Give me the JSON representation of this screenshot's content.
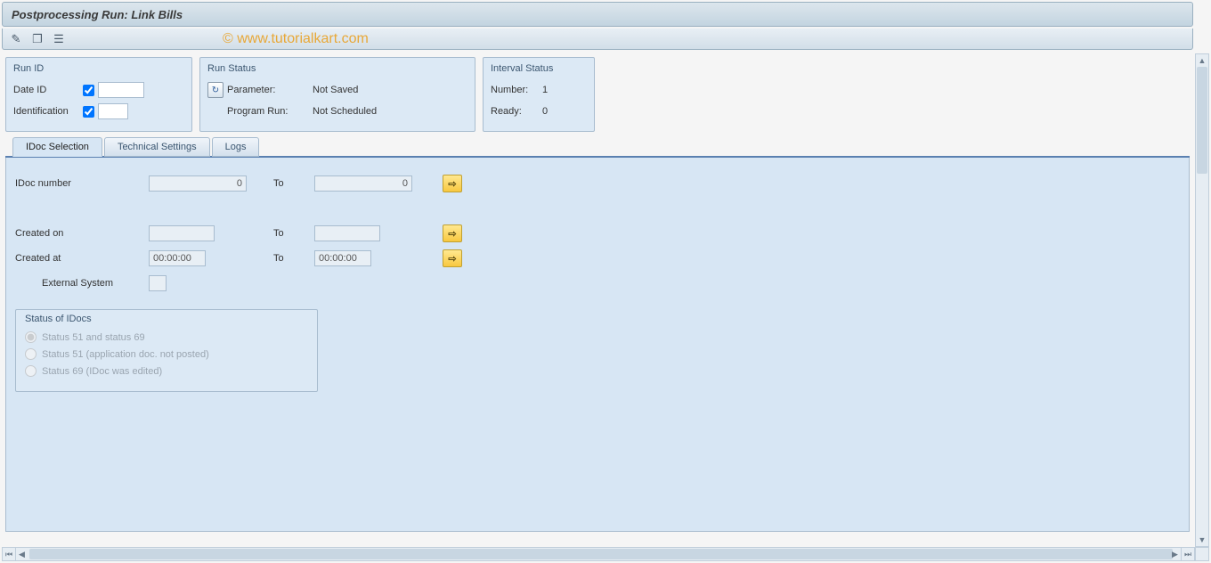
{
  "title": "Postprocessing Run: Link Bills",
  "watermark": "© www.tutorialkart.com",
  "panels": {
    "run_id": {
      "title": "Run ID",
      "date_id_label": "Date ID",
      "identification_label": "Identification"
    },
    "run_status": {
      "title": "Run Status",
      "parameter_label": "Parameter:",
      "parameter_value": "Not Saved",
      "program_run_label": "Program Run:",
      "program_run_value": "Not Scheduled"
    },
    "interval_status": {
      "title": "Interval Status",
      "number_label": "Number:",
      "number_value": "1",
      "ready_label": "Ready:",
      "ready_value": "0"
    }
  },
  "tabs": {
    "idoc_selection": "IDoc Selection",
    "technical_settings": "Technical Settings",
    "logs": "Logs"
  },
  "form": {
    "idoc_number_label": "IDoc number",
    "idoc_number_from": "0",
    "idoc_number_to": "0",
    "to_label": "To",
    "created_on_label": "Created on",
    "created_on_from": "",
    "created_on_to": "",
    "created_at_label": "Created at",
    "created_at_from": "00:00:00",
    "created_at_to": "00:00:00",
    "external_system_label": "External System",
    "more_arrow": "⇨"
  },
  "status_group": {
    "title": "Status of IDocs",
    "opt1": "Status 51 and status 69",
    "opt2": "Status 51 (application doc. not posted)",
    "opt3": "Status 69 (IDoc was edited)"
  }
}
